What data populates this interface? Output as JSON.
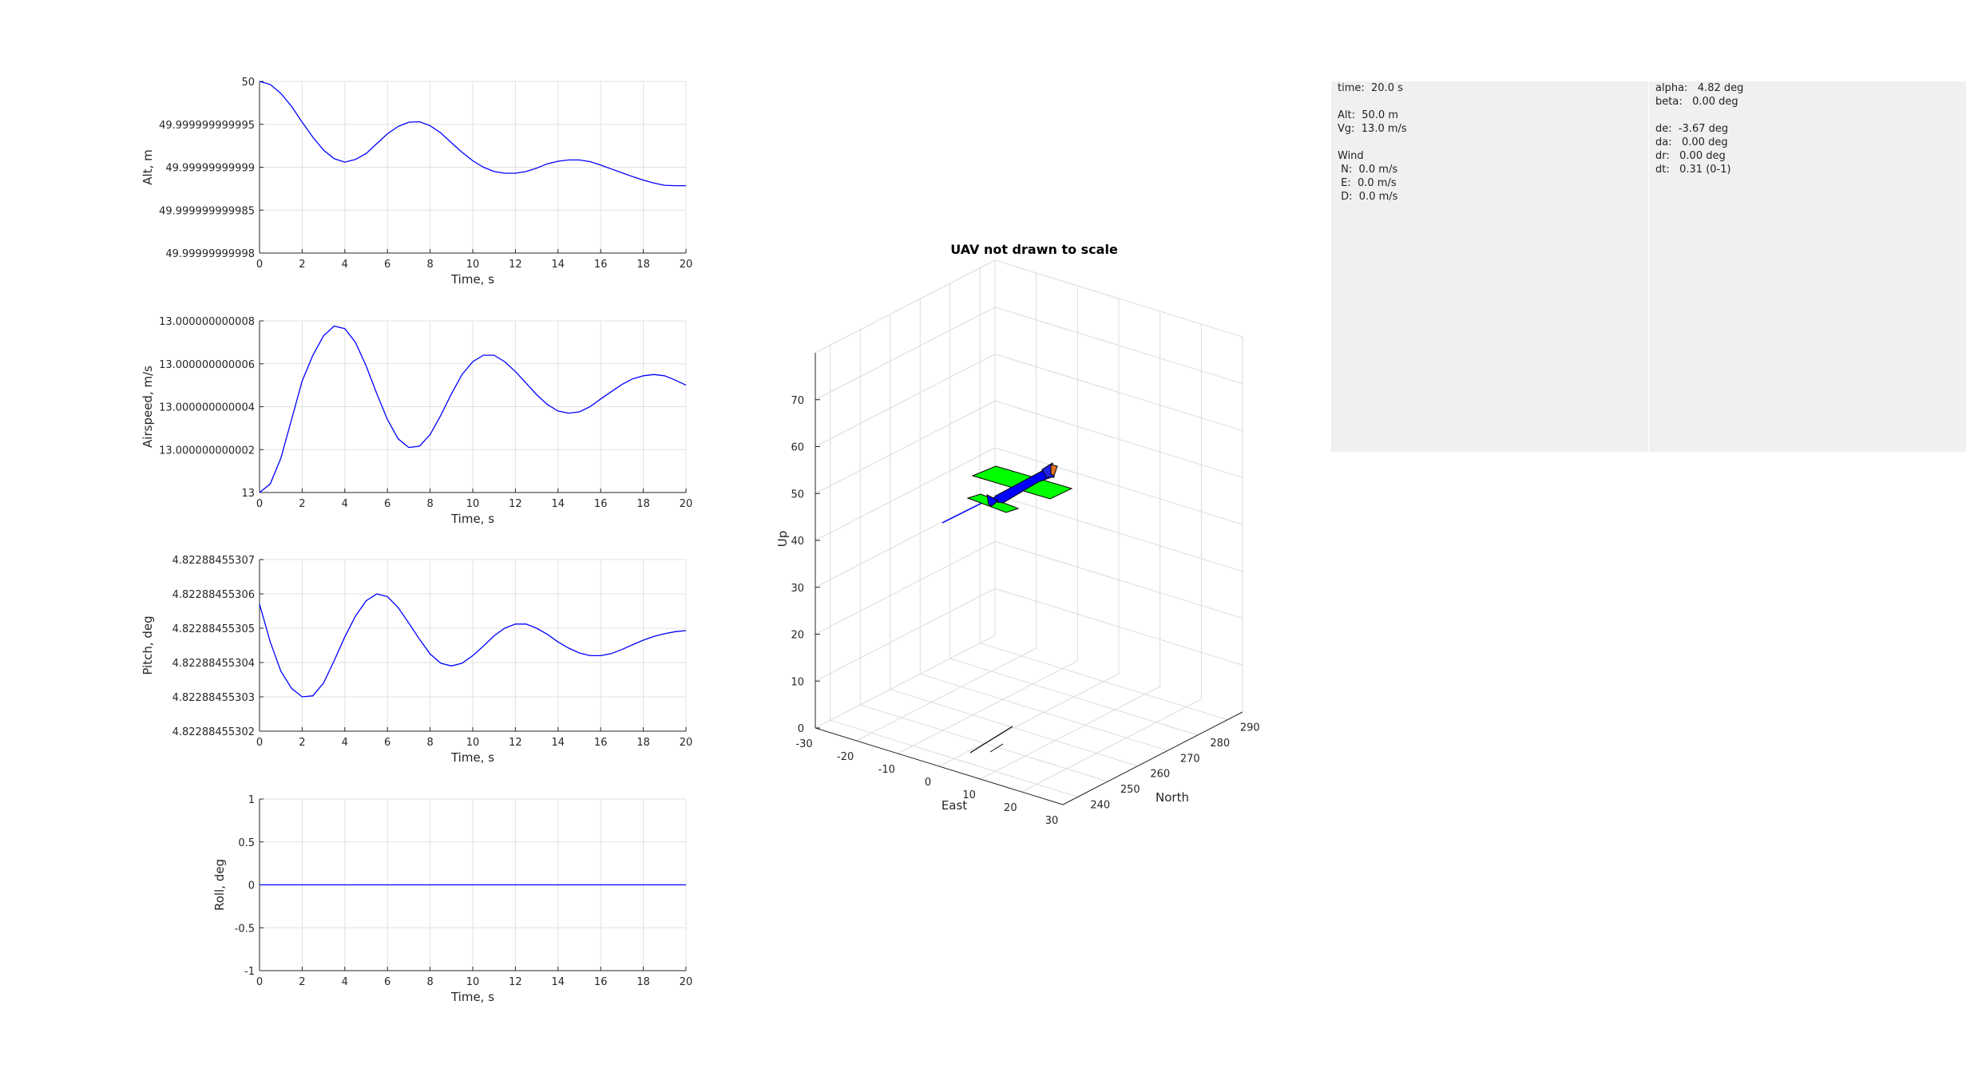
{
  "colors": {
    "line": "#0000ff",
    "grid": "#e0e0e0",
    "axis": "#262626",
    "panel": "#f0f0f0",
    "wing": "#00ff00",
    "body": "#0000ff"
  },
  "chart_data": [
    {
      "type": "line",
      "xlabel": "Time, s",
      "ylabel": "Alt, m",
      "xlim": [
        0,
        20
      ],
      "ylim": [
        0,
        4
      ],
      "xticks": [
        "0",
        "2",
        "4",
        "6",
        "8",
        "10",
        "12",
        "14",
        "16",
        "18",
        "20"
      ],
      "yticks": [
        "49.99999999998",
        "49.999999999985",
        "49.99999999999",
        "49.999999999995",
        "50"
      ],
      "grid": true,
      "x": [
        0,
        0.5,
        1,
        1.5,
        2,
        2.5,
        3,
        3.5,
        4,
        4.5,
        5,
        5.5,
        6,
        6.5,
        7,
        7.5,
        8,
        8.5,
        9,
        9.5,
        10,
        10.5,
        11,
        11.5,
        12,
        12.5,
        13,
        13.5,
        14,
        14.5,
        15,
        15.5,
        16,
        16.5,
        17,
        17.5,
        18,
        18.5,
        19,
        19.5,
        20
      ],
      "series": [
        {
          "values": [
            4.0,
            3.93,
            3.72,
            3.42,
            3.05,
            2.7,
            2.4,
            2.2,
            2.12,
            2.18,
            2.32,
            2.55,
            2.78,
            2.95,
            3.05,
            3.06,
            2.97,
            2.8,
            2.57,
            2.35,
            2.15,
            2.0,
            1.9,
            1.86,
            1.86,
            1.9,
            1.98,
            2.08,
            2.14,
            2.17,
            2.17,
            2.13,
            2.05,
            1.96,
            1.87,
            1.78,
            1.7,
            1.63,
            1.58,
            1.57,
            1.57
          ]
        }
      ]
    },
    {
      "type": "line",
      "xlabel": "Time, s",
      "ylabel": "Airspeed, m/s",
      "xlim": [
        0,
        20
      ],
      "ylim": [
        0,
        4
      ],
      "xticks": [
        "0",
        "2",
        "4",
        "6",
        "8",
        "10",
        "12",
        "14",
        "16",
        "18",
        "20"
      ],
      "yticks": [
        "13",
        "13.000000000002",
        "13.000000000004",
        "13.000000000006",
        "13.000000000008"
      ],
      "grid": true,
      "x": [
        0,
        0.5,
        1,
        1.5,
        2,
        2.5,
        3,
        3.5,
        4,
        4.5,
        5,
        5.5,
        6,
        6.5,
        7,
        7.5,
        8,
        8.5,
        9,
        9.5,
        10,
        10.5,
        11,
        11.5,
        12,
        12.5,
        13,
        13.5,
        14,
        14.5,
        15,
        15.5,
        16,
        16.5,
        17,
        17.5,
        18,
        18.5,
        19,
        19.5,
        20
      ],
      "series": [
        {
          "values": [
            0.0,
            0.2,
            0.8,
            1.7,
            2.6,
            3.2,
            3.65,
            3.88,
            3.82,
            3.5,
            2.95,
            2.3,
            1.7,
            1.25,
            1.05,
            1.08,
            1.35,
            1.8,
            2.3,
            2.75,
            3.05,
            3.2,
            3.2,
            3.05,
            2.82,
            2.55,
            2.28,
            2.05,
            1.9,
            1.85,
            1.88,
            2.0,
            2.18,
            2.35,
            2.52,
            2.65,
            2.72,
            2.75,
            2.72,
            2.62,
            2.5
          ]
        }
      ]
    },
    {
      "type": "line",
      "xlabel": "Time, s",
      "ylabel": "Pitch, deg",
      "xlim": [
        0,
        20
      ],
      "ylim": [
        0,
        5
      ],
      "xticks": [
        "0",
        "2",
        "4",
        "6",
        "8",
        "10",
        "12",
        "14",
        "16",
        "18",
        "20"
      ],
      "yticks": [
        "4.82288455302",
        "4.82288455303",
        "4.82288455304",
        "4.82288455305",
        "4.82288455306",
        "4.82288455307"
      ],
      "grid": true,
      "x": [
        0,
        0.5,
        1,
        1.5,
        2,
        2.5,
        3,
        3.5,
        4,
        4.5,
        5,
        5.5,
        6,
        6.5,
        7,
        7.5,
        8,
        8.5,
        9,
        9.5,
        10,
        10.5,
        11,
        11.5,
        12,
        12.5,
        13,
        13.5,
        14,
        14.5,
        15,
        15.5,
        16,
        16.5,
        17,
        17.5,
        18,
        18.5,
        19,
        19.5,
        20
      ],
      "series": [
        {
          "values": [
            3.7,
            2.6,
            1.75,
            1.25,
            1.0,
            1.03,
            1.4,
            2.05,
            2.75,
            3.35,
            3.8,
            4.0,
            3.92,
            3.6,
            3.15,
            2.68,
            2.25,
            1.98,
            1.9,
            1.98,
            2.2,
            2.48,
            2.78,
            3.0,
            3.12,
            3.12,
            3.0,
            2.82,
            2.6,
            2.42,
            2.28,
            2.2,
            2.2,
            2.26,
            2.38,
            2.52,
            2.65,
            2.76,
            2.84,
            2.9,
            2.93
          ]
        }
      ]
    },
    {
      "type": "line",
      "xlabel": "Time, s",
      "ylabel": "Roll, deg",
      "xlim": [
        0,
        20
      ],
      "ylim": [
        -1,
        1
      ],
      "xticks": [
        "0",
        "2",
        "4",
        "6",
        "8",
        "10",
        "12",
        "14",
        "16",
        "18",
        "20"
      ],
      "yticks": [
        "-1",
        "-0.5",
        "0",
        "0.5",
        "1"
      ],
      "grid": true,
      "x": [
        0,
        20
      ],
      "series": [
        {
          "values": [
            0,
            0
          ]
        }
      ]
    },
    {
      "type": "scatter",
      "title": "UAV not drawn to scale",
      "xlabel": "East",
      "ylabel": "North",
      "zlabel": "Up",
      "xlim": [
        -30,
        30
      ],
      "ylim": [
        235,
        295
      ],
      "zlim": [
        0,
        80
      ],
      "xticks": [
        "-30",
        "-20",
        "-10",
        "0",
        "10",
        "20",
        "30"
      ],
      "yticks": [
        "240",
        "250",
        "260",
        "270",
        "280",
        "290"
      ],
      "zticks": [
        "0",
        "10",
        "20",
        "30",
        "40",
        "50",
        "60",
        "70"
      ],
      "grid": true,
      "uav_position": {
        "east": 0,
        "north": 260,
        "up": 50
      }
    }
  ],
  "status_panel": {
    "left_lines": [
      "time:  20.0 s",
      "",
      "Alt:  50.0 m",
      "Vg:  13.0 m/s",
      "",
      "Wind",
      " N:  0.0 m/s",
      " E:  0.0 m/s",
      " D:  0.0 m/s"
    ],
    "right_lines": [
      "alpha:   4.82 deg",
      "beta:   0.00 deg",
      "",
      "de:  -3.67 deg",
      "da:   0.00 deg",
      "dr:   0.00 deg",
      "dt:   0.31 (0-1)"
    ]
  }
}
